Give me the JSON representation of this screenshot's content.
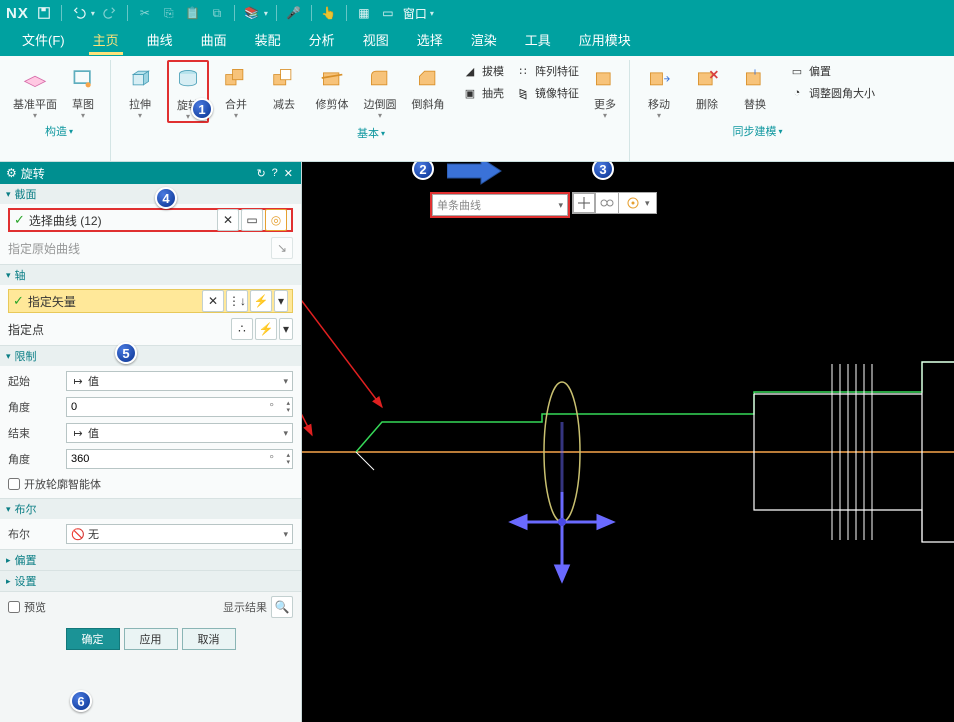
{
  "titlebar": {
    "app": "NX",
    "window_menu": "窗口"
  },
  "menubar": {
    "items": [
      "文件(F)",
      "主页",
      "曲线",
      "曲面",
      "装配",
      "分析",
      "视图",
      "选择",
      "渲染",
      "工具",
      "应用模块"
    ],
    "active_index": 1
  },
  "ribbon": {
    "group_construct": {
      "label": "构造",
      "items": [
        {
          "id": "datum-plane",
          "label": "基准平面"
        },
        {
          "id": "sketch",
          "label": "草图"
        }
      ]
    },
    "group_basic": {
      "label": "基本",
      "items": [
        {
          "id": "extrude",
          "label": "拉伸"
        },
        {
          "id": "revolve",
          "label": "旋转"
        },
        {
          "id": "unite",
          "label": "合并"
        },
        {
          "id": "subtract",
          "label": "减去"
        },
        {
          "id": "trim-body",
          "label": "修剪体"
        },
        {
          "id": "edge-blend",
          "label": "边倒圆"
        },
        {
          "id": "chamfer",
          "label": "倒斜角"
        }
      ],
      "side_items": [
        {
          "id": "draft",
          "label": "拔模"
        },
        {
          "id": "pattern",
          "label": "阵列特征"
        },
        {
          "id": "shell",
          "label": "抽壳"
        },
        {
          "id": "mirror",
          "label": "镜像特征"
        }
      ],
      "more": "更多"
    },
    "group_sync": {
      "label": "同步建模",
      "items": [
        {
          "id": "move",
          "label": "移动"
        },
        {
          "id": "delete",
          "label": "删除"
        },
        {
          "id": "replace",
          "label": "替换"
        }
      ],
      "side_items": [
        {
          "id": "offset",
          "label": "偏置"
        },
        {
          "id": "resize-blend",
          "label": "调整圆角大小"
        }
      ]
    }
  },
  "curve_filter": {
    "value": "单条曲线"
  },
  "panel": {
    "title": "旋转",
    "section_profile": {
      "title": "截面",
      "select_curve": "选择曲线 (12)",
      "specify_origin": "指定原始曲线"
    },
    "section_axis": {
      "title": "轴",
      "specify_vector": "指定矢量",
      "specify_point": "指定点"
    },
    "section_limits": {
      "title": "限制",
      "start": "起始",
      "angle": "角度",
      "end": "结束",
      "start_type": "值",
      "end_type": "值",
      "start_val": "0",
      "end_val": "360",
      "open_profile": "开放轮廓智能体"
    },
    "section_bool": {
      "title": "布尔",
      "label": "布尔",
      "value": "无"
    },
    "section_offset": {
      "title": "偏置"
    },
    "section_settings": {
      "title": "设置"
    },
    "preview": "预览",
    "show_result": "显示结果",
    "ok": "确定",
    "apply": "应用",
    "cancel": "取消",
    "unit": "°"
  },
  "badges": {
    "b1": "1",
    "b2": "2",
    "b3": "3",
    "b4": "4",
    "b5": "5",
    "b6": "6"
  }
}
